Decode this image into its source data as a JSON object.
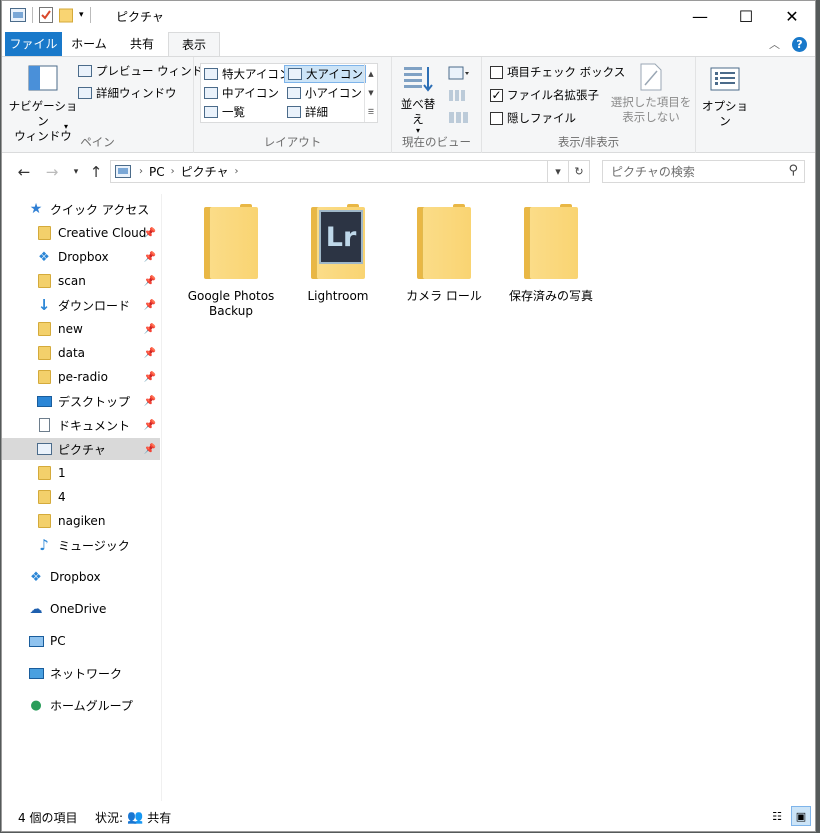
{
  "window": {
    "title": "ピクチャ",
    "controls": {
      "minimize": "—",
      "maximize": "☐",
      "close": "✕"
    }
  },
  "ribbon_tabs": [
    "ファイル",
    "ホーム",
    "共有",
    "表示"
  ],
  "ribbon_active_tab": "表示",
  "ribbon": {
    "panes": {
      "navigation_pane": "ナビゲーション\nウィンドウ",
      "preview_pane": "プレビュー ウィンドウ",
      "details_pane": "詳細ウィンドウ",
      "label": "ペイン"
    },
    "layout": {
      "items": [
        "特大アイコン",
        "大アイコン",
        "中アイコン",
        "小アイコン",
        "一覧",
        "詳細"
      ],
      "selected": "大アイコン",
      "label": "レイアウト"
    },
    "current_view": {
      "sort": "並べ替え",
      "label": "現在のビュー"
    },
    "show_hide": {
      "item_checkboxes": "項目チェック ボックス",
      "item_checkboxes_checked": false,
      "file_extensions": "ファイル名拡張子",
      "file_extensions_checked": true,
      "hidden_items": "隠しファイル",
      "hidden_items_checked": false,
      "hide_selected": "選択した項目を\n表示しない",
      "label": "表示/非表示"
    },
    "options": "オプション"
  },
  "address": {
    "crumbs": [
      "PC",
      "ピクチャ"
    ],
    "search_placeholder": "ピクチャの検索"
  },
  "sidebar": {
    "quick_access": "クイック アクセス",
    "quick_items": [
      {
        "label": "Creative Cloud Fi",
        "icon": "creative-cloud-icon",
        "pinned": true
      },
      {
        "label": "Dropbox",
        "icon": "dropbox-icon",
        "pinned": true
      },
      {
        "label": "scan",
        "icon": "folder-icon",
        "pinned": true
      },
      {
        "label": "ダウンロード",
        "icon": "download-icon",
        "pinned": true
      },
      {
        "label": "new",
        "icon": "folder-icon",
        "pinned": true
      },
      {
        "label": "data",
        "icon": "folder-icon",
        "pinned": true
      },
      {
        "label": "pe-radio",
        "icon": "folder-icon",
        "pinned": true
      },
      {
        "label": "デスクトップ",
        "icon": "desktop-icon",
        "pinned": true
      },
      {
        "label": "ドキュメント",
        "icon": "document-icon",
        "pinned": true
      },
      {
        "label": "ピクチャ",
        "icon": "pictures-icon",
        "pinned": true,
        "selected": true
      },
      {
        "label": "1",
        "icon": "folder-icon",
        "pinned": false
      },
      {
        "label": "4",
        "icon": "folder-icon",
        "pinned": false
      },
      {
        "label": "nagiken",
        "icon": "folder-icon",
        "pinned": false
      },
      {
        "label": "ミュージック",
        "icon": "music-icon",
        "pinned": false
      }
    ],
    "roots": [
      {
        "label": "Dropbox",
        "icon": "dropbox-icon"
      },
      {
        "label": "OneDrive",
        "icon": "onedrive-icon"
      },
      {
        "label": "PC",
        "icon": "pc-icon"
      },
      {
        "label": "ネットワーク",
        "icon": "network-icon"
      },
      {
        "label": "ホームグループ",
        "icon": "homegroup-icon"
      }
    ]
  },
  "content": {
    "items": [
      {
        "name": "Google Photos\nBackup",
        "type": "folder"
      },
      {
        "name": "Lightroom",
        "type": "lightroom-folder",
        "badge": "Lr"
      },
      {
        "name": "カメラ ロール",
        "type": "folder"
      },
      {
        "name": "保存済みの写真",
        "type": "folder"
      }
    ]
  },
  "status": {
    "count": "4 個の項目",
    "state_label": "状況:",
    "state_value": "共有"
  },
  "colors": {
    "accent": "#1979ca",
    "folder": "#f9d472",
    "selected": "#cce4f7"
  }
}
